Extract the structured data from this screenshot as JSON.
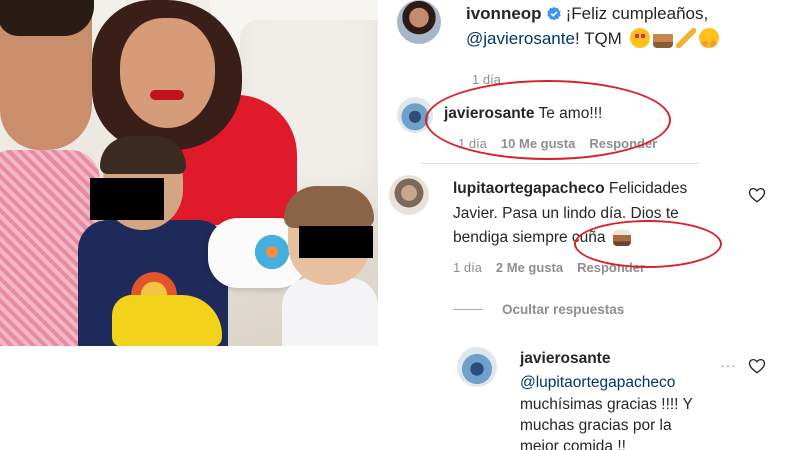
{
  "post_comment": {
    "username": "ivonneop",
    "text_line1": "¡Feliz cumpleaños,",
    "mention": "@javierosante",
    "text_line2_rest": "! TQM",
    "emojis": [
      "heart-eyes-emoji",
      "cake-emoji",
      "party-popper-emoji",
      "hugging-face-emoji"
    ],
    "time": "1 día"
  },
  "reply_1": {
    "username": "javierosante",
    "text": "Te amo!!!",
    "time": "1 día",
    "likes": "10 Me gusta",
    "reply_label": "Responder"
  },
  "comment_2": {
    "username": "lupitaortegapacheco",
    "text_line1": "Felicidades",
    "text_line2": "Javier. Pasa un lindo día. Dios te",
    "text_line3": "bendiga siempre cuña",
    "emoji": "cake-emoji",
    "time": "1 día",
    "likes": "2 Me gusta",
    "reply_label": "Responder",
    "hide_replies_label": "Ocultar respuestas"
  },
  "reply_2": {
    "username": "javierosante",
    "mention": "@lupitaortegapacheco",
    "text_line1": "muchísimas gracias !!!! Y",
    "text_line2": "muchas gracias por la",
    "text_line3": "mejor comida !!"
  },
  "colors": {
    "annotation_circle": "#d8222b",
    "verified_badge": "#3897f0",
    "mention": "#00376b",
    "meta_gray": "#8e8e8e"
  }
}
